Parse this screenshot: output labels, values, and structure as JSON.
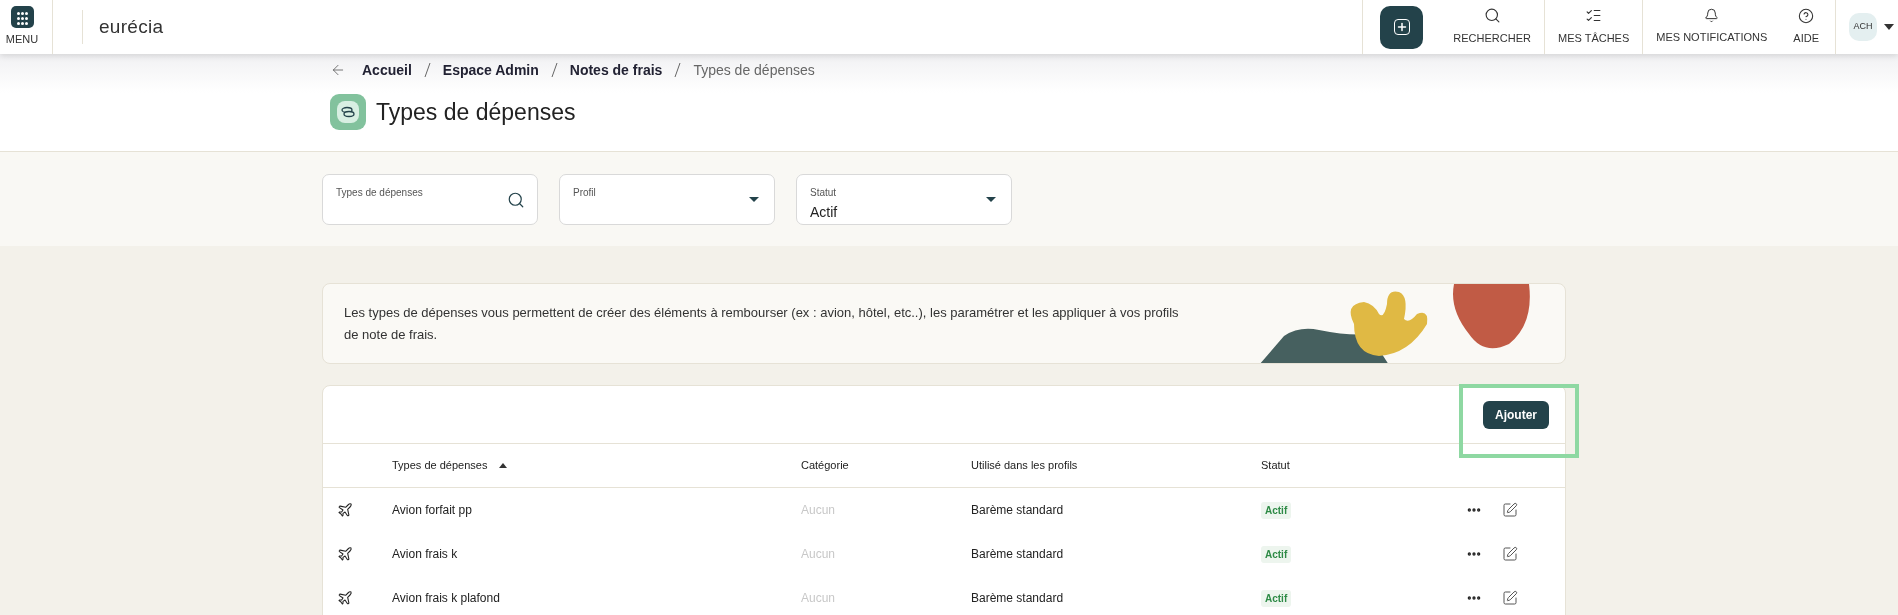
{
  "topbar": {
    "menu_label": "MENU",
    "logo": "eurécia",
    "actions": [
      {
        "kind": "search",
        "label": "RECHERCHER"
      },
      {
        "kind": "tasks",
        "label": "MES TÂCHES"
      },
      {
        "kind": "bell",
        "label": "MES NOTIFICATIONS"
      },
      {
        "kind": "help",
        "label": "AIDE"
      }
    ],
    "avatar": "ACH"
  },
  "breadcrumb": [
    {
      "label": "Accueil",
      "current": false
    },
    {
      "label": "Espace Admin",
      "current": false
    },
    {
      "label": "Notes de frais",
      "current": false
    },
    {
      "label": "Types de dépenses",
      "current": true
    }
  ],
  "title": "Types de dépenses",
  "filters": [
    {
      "kind": "search",
      "label": "Types de dépenses"
    },
    {
      "kind": "select",
      "label": "Profil"
    },
    {
      "kind": "select",
      "label": "Statut",
      "value": "Actif"
    }
  ],
  "info": "Les types de dépenses vous permettent de créer des éléments à rembourser (ex : avion, hôtel, etc..), les paramétrer et les appliquer à vos profils de note de frais.",
  "add_button": "Ajouter",
  "table": {
    "columns": [
      {
        "label": "Types de dépenses",
        "sorted": true
      },
      {
        "label": "Catégorie",
        "sorted": false
      },
      {
        "label": "Utilisé dans les profils",
        "sorted": false
      },
      {
        "label": "Statut",
        "sorted": false
      }
    ],
    "rows": [
      {
        "name": "Avion forfait pp",
        "category": "Aucun",
        "profiles": "Barème standard",
        "status": "Actif"
      },
      {
        "name": "Avion frais k",
        "category": "Aucun",
        "profiles": "Barème standard",
        "status": "Actif"
      },
      {
        "name": "Avion frais k plafond",
        "category": "Aucun",
        "profiles": "Barème standard",
        "status": "Actif"
      }
    ]
  }
}
